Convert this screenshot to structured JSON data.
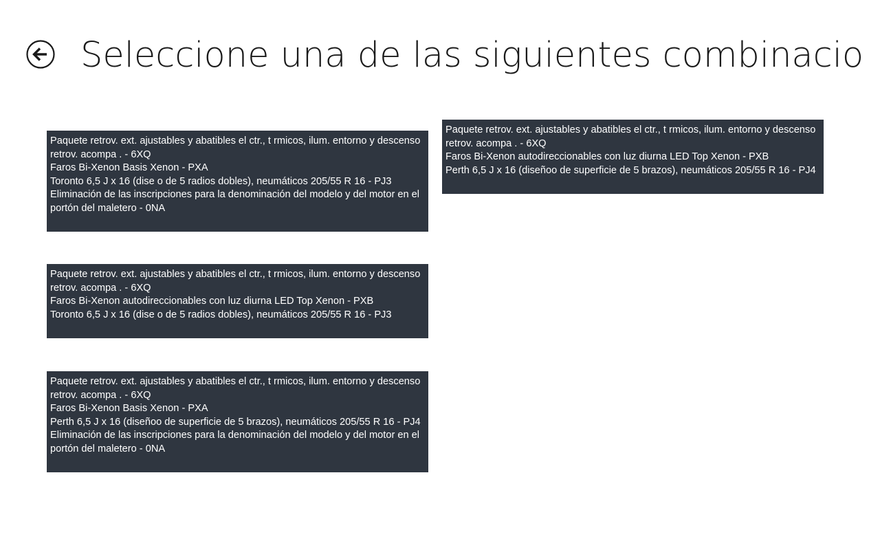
{
  "header": {
    "title": "Seleccione una de las siguientes combinaciones",
    "back_icon": "back-arrow-icon"
  },
  "colors": {
    "tile_background": "#2f3640",
    "tile_text": "#ffffff",
    "title_text": "#1a1a1a"
  },
  "combinations": [
    {
      "lines": [
        "Paquete retrov. ext. ajustables y abatibles el ctr., t rmicos, ilum. entorno y descenso retrov. acompa . - 6XQ",
        "Faros Bi-Xenon Basis Xenon - PXA",
        "Toronto 6,5 J x 16 (dise o de 5 radios dobles), neumáticos 205/55 R 16 - PJ3",
        "Eliminación de las inscripciones para la denominación del modelo y del motor en el portón del maletero - 0NA"
      ]
    },
    {
      "lines": [
        "Paquete retrov. ext. ajustables y abatibles el ctr., t rmicos, ilum. entorno y descenso retrov. acompa . - 6XQ",
        "Faros Bi-Xenon autodireccionables con luz diurna LED Top Xenon - PXB",
        "Toronto 6,5 J x 16 (dise o de 5 radios dobles), neumáticos 205/55 R 16 - PJ3"
      ]
    },
    {
      "lines": [
        "Paquete retrov. ext. ajustables y abatibles el ctr., t rmicos, ilum. entorno y descenso retrov. acompa . - 6XQ",
        "Faros Bi-Xenon Basis Xenon - PXA",
        "Perth 6,5 J x 16 (diseñoo de superficie de 5 brazos), neumáticos 205/55 R 16 - PJ4",
        "Eliminación de las inscripciones para la denominación del modelo y del motor en el portón del maletero - 0NA"
      ]
    },
    {
      "lines": [
        "Paquete retrov. ext. ajustables y abatibles el ctr., t rmicos, ilum. entorno y descenso retrov. acompa . - 6XQ",
        "Faros Bi-Xenon autodireccionables con luz diurna LED Top Xenon - PXB",
        "Perth 6,5 J x 16 (diseñoo de superficie de 5 brazos), neumáticos 205/55 R 16 - PJ4"
      ]
    }
  ]
}
